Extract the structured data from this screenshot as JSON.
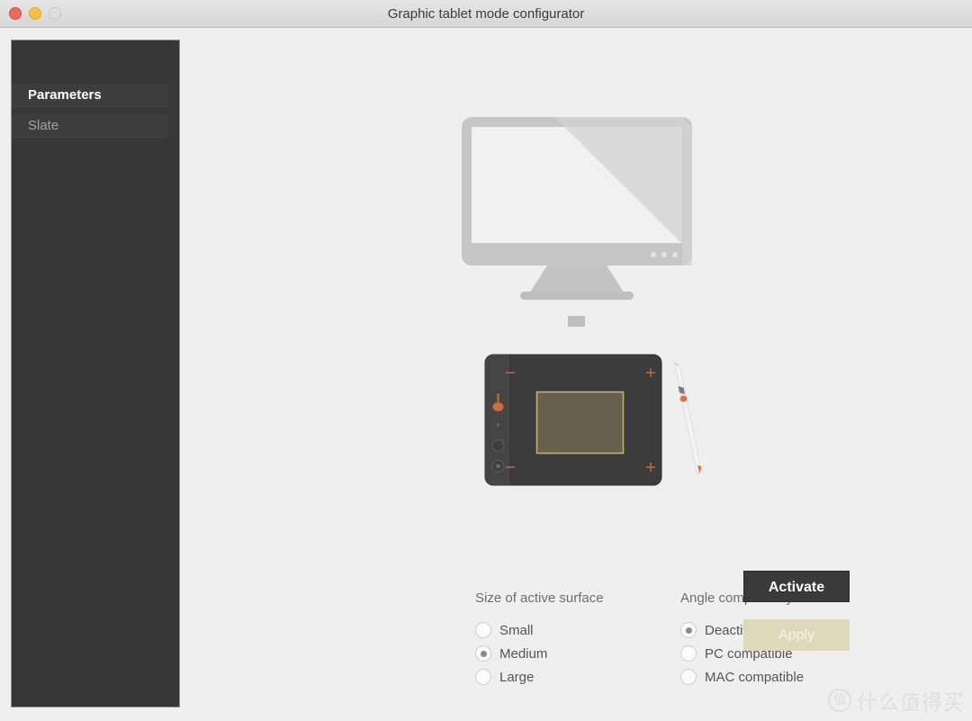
{
  "window": {
    "title": "Graphic tablet mode configurator",
    "background_color": "#EFEFEF",
    "titlebar_color": "#DCDCDC",
    "controls": [
      {
        "name": "close",
        "color": "#ED6A5E"
      },
      {
        "name": "minimize",
        "color": "#F5C046"
      },
      {
        "name": "zoom",
        "color": "#DFDFDF"
      }
    ]
  },
  "sidebar": {
    "background_color": "#373737",
    "items": [
      {
        "label": "Parameters",
        "selected": true
      },
      {
        "label": "Slate",
        "selected": false
      }
    ]
  },
  "illustration": {
    "monitor": {
      "name": "display-monitor",
      "body_color": "#C3C3C3",
      "screen_color": "#EFEFEF"
    },
    "tablet": {
      "name": "graphic-tablet",
      "body_color": "#3C3C3C",
      "active_surface_color": "#67604D",
      "active_surface_border_color": "#C0B173",
      "accent_color": "#C96F3A"
    },
    "stylus": {
      "name": "stylus-pen",
      "body_color": "#F2F2F2",
      "accent_color": "#D9743F"
    }
  },
  "options": {
    "size": {
      "title": "Size of active surface",
      "choices": [
        {
          "label": "Small",
          "selected": false
        },
        {
          "label": "Medium",
          "selected": true
        },
        {
          "label": "Large",
          "selected": false
        }
      ]
    },
    "angle": {
      "title": "Angle compatibility",
      "choices": [
        {
          "label": "Deactivate",
          "selected": true
        },
        {
          "label": "PC compatible",
          "selected": false
        },
        {
          "label": "MAC compatible",
          "selected": false
        }
      ]
    }
  },
  "buttons": {
    "activate": {
      "label": "Activate",
      "background": "#3A3A3A",
      "text_color": "#FFFFFF",
      "enabled": true
    },
    "apply": {
      "label": "Apply",
      "background": "#DFD8BC",
      "text_color": "#F6F3EA",
      "enabled": false
    }
  },
  "watermark": {
    "badge": "值",
    "text": "什么值得买"
  }
}
